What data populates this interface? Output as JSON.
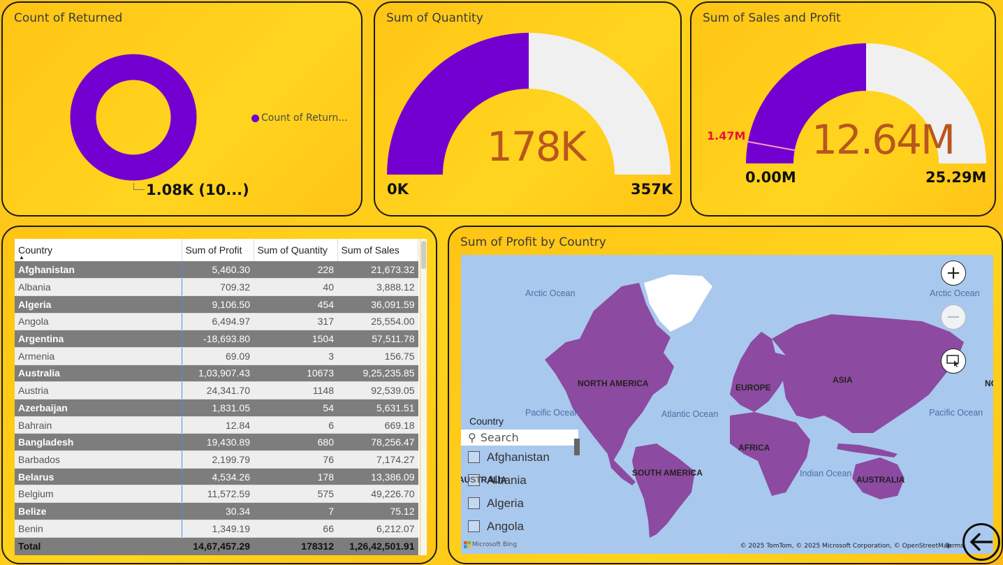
{
  "returned": {
    "title": "Count of Returned",
    "legend": "Count of Return...",
    "label": "1.08K (10...)",
    "color": "#7300d0"
  },
  "quantity": {
    "title": "Sum of Quantity",
    "value": "178K",
    "min": "0K",
    "max": "357K",
    "fill_fraction": 0.5,
    "fill_color": "#7300d0",
    "track_color": "#f0f0f0"
  },
  "sales": {
    "title": "Sum of Sales and Profit",
    "value": "12.64M",
    "min": "0.00M",
    "max": "25.29M",
    "target": "1.47M",
    "fill_fraction": 0.5,
    "target_fraction": 0.058
  },
  "table": {
    "headers": [
      "Country",
      "Sum of Profit",
      "Sum of Quantity",
      "Sum of Sales"
    ],
    "rows": [
      [
        "Afghanistan",
        "5,460.30",
        "228",
        "21,673.32"
      ],
      [
        "Albania",
        "709.32",
        "40",
        "3,888.12"
      ],
      [
        "Algeria",
        "9,106.50",
        "454",
        "36,091.59"
      ],
      [
        "Angola",
        "6,494.97",
        "317",
        "25,554.00"
      ],
      [
        "Argentina",
        "-18,693.80",
        "1504",
        "57,511.78"
      ],
      [
        "Armenia",
        "69.09",
        "3",
        "156.75"
      ],
      [
        "Australia",
        "1,03,907.43",
        "10673",
        "9,25,235.85"
      ],
      [
        "Austria",
        "24,341.70",
        "1148",
        "92,539.05"
      ],
      [
        "Azerbaijan",
        "1,831.05",
        "54",
        "5,631.51"
      ],
      [
        "Bahrain",
        "12.84",
        "6",
        "669.18"
      ],
      [
        "Bangladesh",
        "19,430.89",
        "680",
        "78,256.47"
      ],
      [
        "Barbados",
        "2,199.79",
        "76",
        "7,174.27"
      ],
      [
        "Belarus",
        "4,534.26",
        "178",
        "13,386.09"
      ],
      [
        "Belgium",
        "11,572.59",
        "575",
        "49,226.70"
      ],
      [
        "Belize",
        "30.34",
        "7",
        "75.12"
      ],
      [
        "Benin",
        "1,349.19",
        "66",
        "6,212.07"
      ]
    ],
    "total": [
      "Total",
      "14,67,457.29",
      "178312",
      "1,26,42,501.91"
    ]
  },
  "map": {
    "title": "Sum of Profit by Country",
    "oceans": [
      "Arctic Ocean",
      "Arctic Ocean",
      "Pacific Ocean",
      "Atlantic Ocean",
      "Pacific Ocean",
      "Indian Ocean"
    ],
    "continents": [
      "NORTH AMERICA",
      "EUROPE",
      "ASIA",
      "AFRICA",
      "SOUTH AMERICA",
      "AUSTRALIA",
      "AUSTRALIA",
      "NO"
    ],
    "attribution": "© 2025 TomTom, © 2025 Microsoft Corporation, © OpenStreetMap",
    "terms": "Terms",
    "bing": "Microsoft Bing",
    "land_color": "#8c4aa0"
  },
  "slicer": {
    "title": "Country",
    "search_placeholder": "Search",
    "items": [
      "Afghanistan",
      "Albania",
      "Algeria",
      "Angola"
    ]
  }
}
